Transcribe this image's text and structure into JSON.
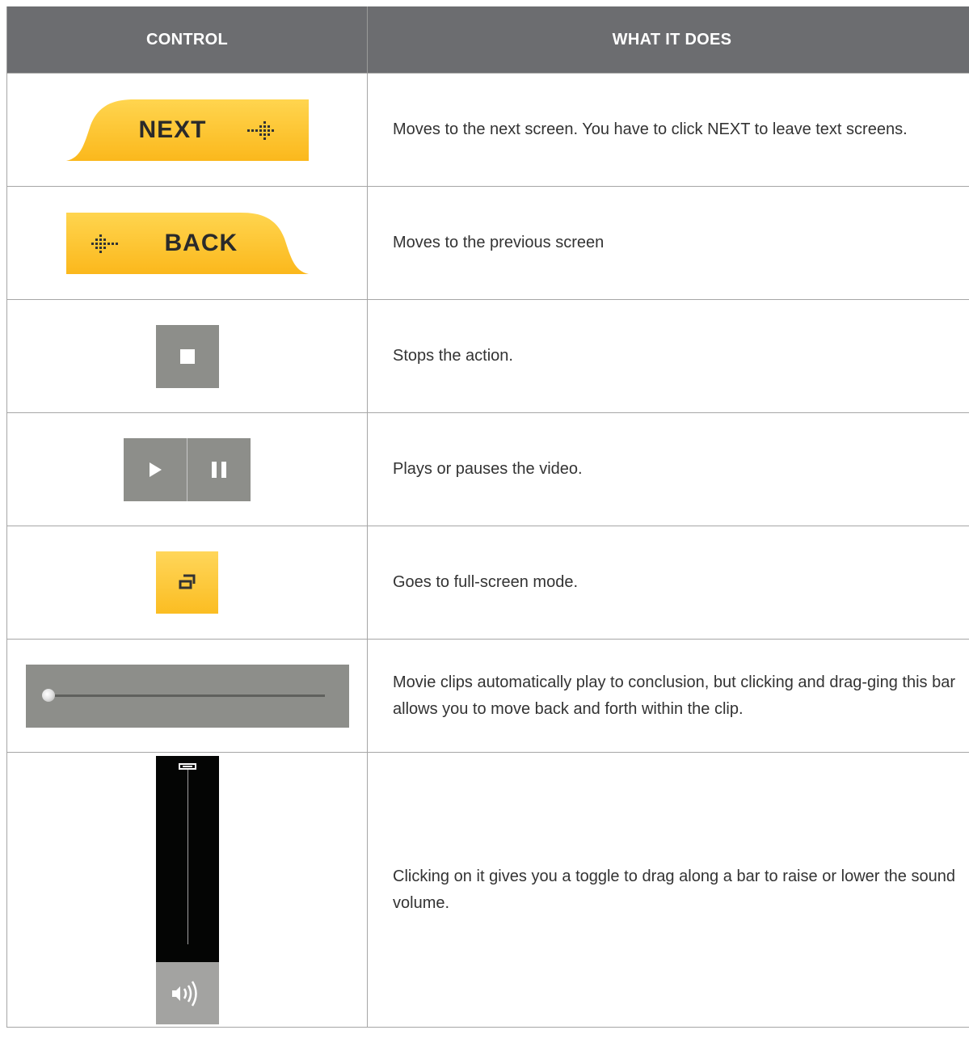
{
  "table": {
    "header": {
      "control": "CONTROL",
      "what_it_does": "WHAT IT DOES"
    },
    "rows": [
      {
        "control_label": "NEXT",
        "icon": "next-arrow-icon",
        "description": "Moves to the next screen. You have to click NEXT to leave text screens."
      },
      {
        "control_label": "BACK",
        "icon": "back-arrow-icon",
        "description": "Moves to the previous screen"
      },
      {
        "icon": "stop-icon",
        "description": "Stops the action."
      },
      {
        "icon": "play-icon / pause-icon",
        "description": "Plays or pauses the video."
      },
      {
        "icon": "fullscreen-icon",
        "description": "Goes to full-screen mode."
      },
      {
        "icon": "seek-bar",
        "position_fraction": 0.0,
        "description": "Movie clips automatically play to conclusion, but clicking and drag-ging this bar allows you to move back and forth within the clip."
      },
      {
        "icon": "volume-icon",
        "volume_fraction": 1.0,
        "description": "Clicking on it gives you a toggle to drag along a bar to raise or lower the sound volume."
      }
    ]
  },
  "colors": {
    "header_bg": "#6c6d70",
    "accent_yellow": "#fbbd22",
    "control_gray": "#8d8e8a",
    "volume_track": "#040504"
  }
}
